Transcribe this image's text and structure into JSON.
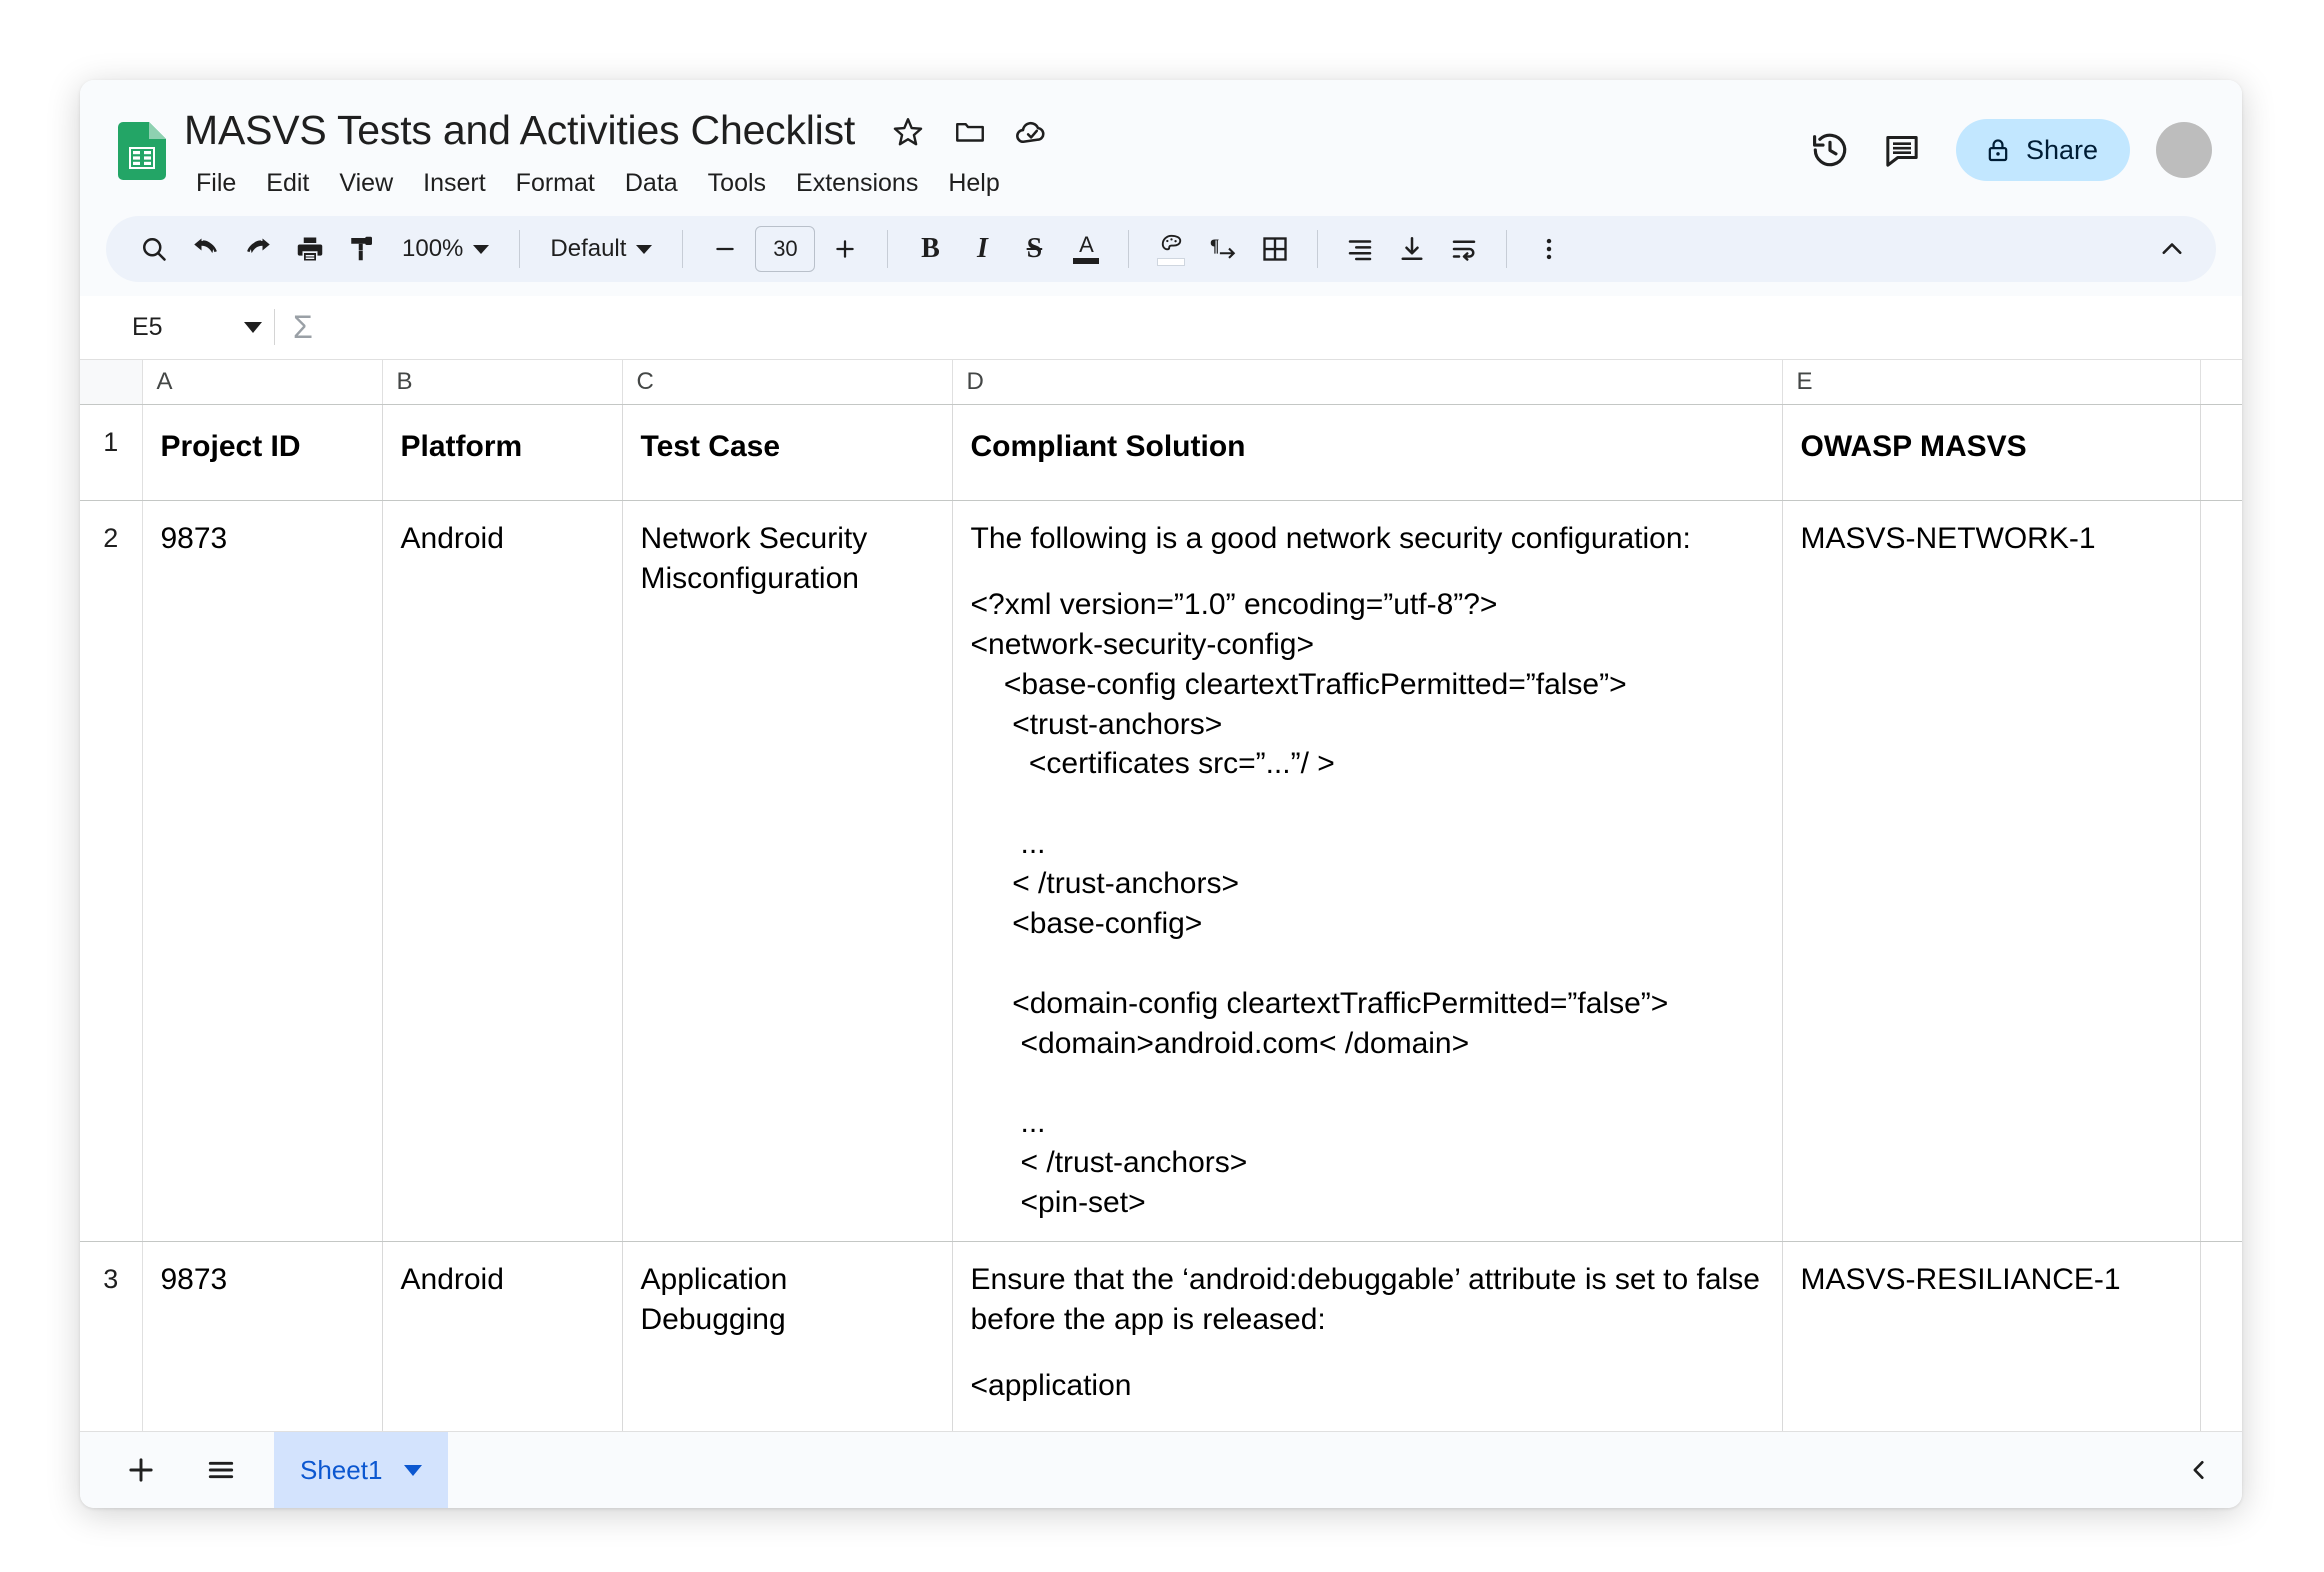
{
  "app": {
    "doc_title": "MASVS Tests and Activities Checklist",
    "title_icons": [
      "star-icon",
      "folder-icon",
      "cloud-done-icon"
    ]
  },
  "menubar": {
    "items": [
      "File",
      "Edit",
      "View",
      "Insert",
      "Format",
      "Data",
      "Tools",
      "Extensions",
      "Help"
    ]
  },
  "header_right": {
    "history_icon": "version-history-icon",
    "comment_icon": "comment-icon",
    "share_label": "Share",
    "share_lock_icon": "lock-icon",
    "share_bg": "#c2e7ff",
    "avatar_color": "#bdbdbd"
  },
  "toolbar": {
    "search_icon": "search-icon",
    "undo_icon": "undo-icon",
    "redo_icon": "redo-icon",
    "print_icon": "print-icon",
    "paint_format_icon": "paint-format-icon",
    "zoom_value": "100%",
    "font_name": "Default",
    "font_size": "30",
    "decrease_label": "−",
    "increase_label": "+",
    "bold_label": "B",
    "italic_label": "I",
    "strikethrough_label": "S",
    "text_color_label": "A",
    "fill_color_icon": "fill-color-icon",
    "text_rotation_icon": "text-rotation-icon",
    "borders_icon": "borders-icon",
    "horizontal_align_icon": "horizontal-align-icon",
    "vertical_align_icon": "vertical-align-icon",
    "text_wrap_icon": "text-wrap-icon",
    "more_icon": "more-options-icon",
    "collapse_icon": "chevron-up-icon",
    "bg": "#edf2fa"
  },
  "formula_bar": {
    "name_box_value": "E5",
    "functions_icon": "sigma-icon"
  },
  "grid": {
    "column_headers": [
      "A",
      "B",
      "C",
      "D",
      "E"
    ],
    "row_numbers": [
      "1",
      "2",
      "3"
    ],
    "header_row": [
      "Project ID",
      "Platform",
      "Test Case",
      "Compliant Solution",
      "OWASP MASVS"
    ],
    "rows": [
      {
        "num": "2",
        "project_id": "9873",
        "platform": "Android",
        "test_case": "Network Security Misconfiguration",
        "solution_intro": "The following is a good network security configuration:",
        "solution_code": "<?xml version=”1.0” encoding=”utf-8”?>\n<network-security-config>\n    <base-config cleartextTrafficPermitted=”false”>\n     <trust-anchors>\n       <certificates src=”...”/ >\n\n      ...\n     < /trust-anchors>\n     <base-config>\n\n     <domain-config cleartextTrafficPermitted=”false”>\n      <domain>android.com< /domain>\n\n      ...\n      < /trust-anchors>\n      <pin-set>",
        "masvs": "MASVS-NETWORK-1"
      },
      {
        "num": "3",
        "project_id": "9873",
        "platform": "Android",
        "test_case": "Application Debugging",
        "solution_intro": "Ensure that the ‘android:debuggable’ attribute is set to false before the app is released:",
        "solution_code": "<application\n\n   ...\n   android:debuggable=”false”>",
        "masvs": "MASVS-RESILIANCE-1"
      }
    ]
  },
  "sheet_bar": {
    "add_sheet_icon": "plus-icon",
    "all_sheets_icon": "all-sheets-icon",
    "active_sheet": "Sheet1",
    "sheet_caret_icon": "chevron-down-icon",
    "collapse_icon": "chevron-left-icon"
  }
}
